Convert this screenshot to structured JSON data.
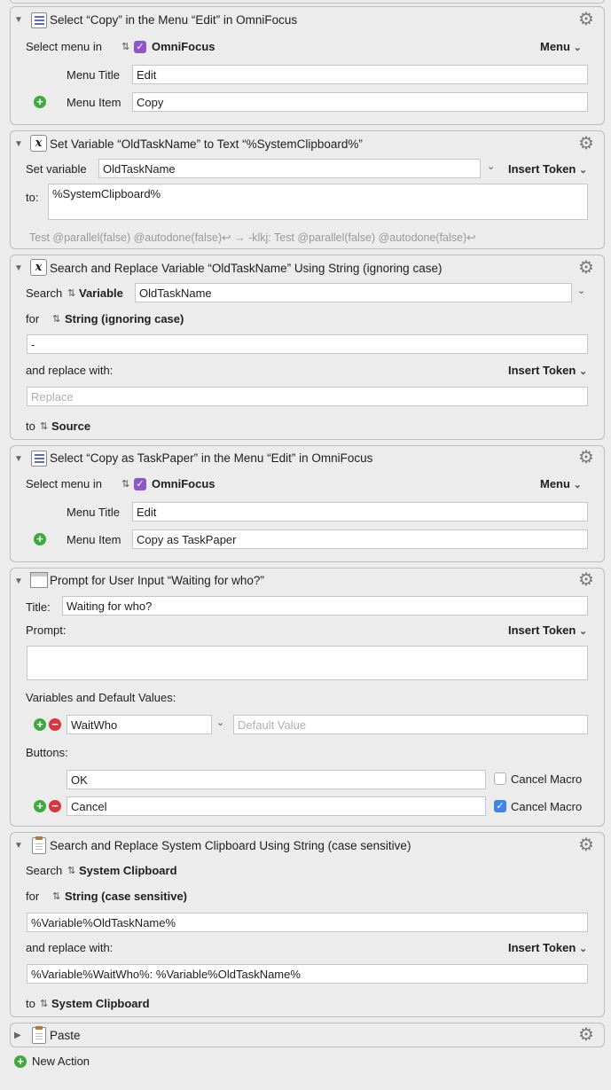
{
  "actions": [
    {
      "title": "Select “Copy” in the Menu “Edit” in OmniFocus",
      "select_label": "Select menu in",
      "app_name": "OmniFocus",
      "menu_dropdown": "Menu",
      "menu_title_label": "Menu Title",
      "menu_title_value": "Edit",
      "menu_item_label": "Menu Item",
      "menu_item_value": "Copy"
    },
    {
      "title": "Set Variable “OldTaskName” to Text “%SystemClipboard%”",
      "set_label": "Set variable",
      "variable_value": "OldTaskName",
      "insert_token": "Insert Token",
      "to_label": "to:",
      "text_value": "%SystemClipboard%",
      "preview": "Test @parallel(false) @autodone(false)↩ → -klkj:  Test @parallel(false) @autodone(false)↩"
    },
    {
      "title": "Search and Replace Variable “OldTaskName” Using String (ignoring case)",
      "search_label": "Search",
      "search_source": "Variable",
      "variable_value": "OldTaskName",
      "for_label": "for",
      "for_mode": "String (ignoring case)",
      "search_value": "-",
      "replace_label": "and replace with:",
      "insert_token": "Insert Token",
      "replace_placeholder": "Replace",
      "to_label": "to",
      "to_dest": "Source"
    },
    {
      "title": "Select “Copy as TaskPaper” in the Menu “Edit” in OmniFocus",
      "select_label": "Select menu in",
      "app_name": "OmniFocus",
      "menu_dropdown": "Menu",
      "menu_title_label": "Menu Title",
      "menu_title_value": "Edit",
      "menu_item_label": "Menu Item",
      "menu_item_value": "Copy as TaskPaper"
    },
    {
      "title": "Prompt for User Input “Waiting for who?”",
      "title_label": "Title:",
      "title_value": "Waiting for who?",
      "prompt_label": "Prompt:",
      "insert_token": "Insert Token",
      "prompt_value": "",
      "vars_label": "Variables and Default Values:",
      "var_name": "WaitWho",
      "default_placeholder": "Default Value",
      "buttons_label": "Buttons:",
      "buttons": [
        {
          "label": "OK",
          "cancel_macro": "Cancel Macro",
          "checked": false
        },
        {
          "label": "Cancel",
          "cancel_macro": "Cancel Macro",
          "checked": true
        }
      ]
    },
    {
      "title": "Search and Replace System Clipboard Using String (case sensitive)",
      "search_label": "Search",
      "search_source": "System Clipboard",
      "for_label": "for",
      "for_mode": "String (case sensitive)",
      "search_value": "%Variable%OldTaskName%",
      "replace_label": "and replace with:",
      "insert_token": "Insert Token",
      "replace_value": "%Variable%WaitWho%: %Variable%OldTaskName%",
      "to_label": "to",
      "to_dest": "System Clipboard"
    },
    {
      "title": "Paste"
    }
  ],
  "new_action": "New Action",
  "colors": {
    "accent_purple": "#8d57c9",
    "add_green": "#3eaa3e",
    "remove_red": "#d9363b",
    "check_blue": "#3d86e8"
  }
}
